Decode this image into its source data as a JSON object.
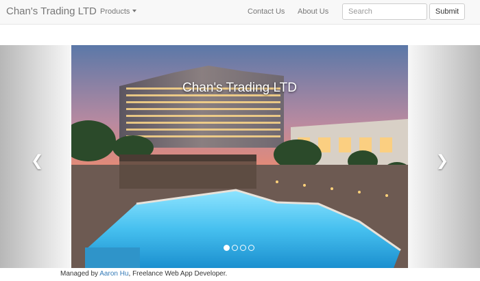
{
  "navbar": {
    "brand": "Chan's Trading LTD",
    "products_label": "Products",
    "contact_label": "Contact Us",
    "about_label": "About Us",
    "search_placeholder": "Search",
    "submit_label": "Submit"
  },
  "carousel": {
    "caption": "Chan's Trading LTD",
    "left_icon": "chevron-left-icon",
    "right_icon": "chevron-right-icon",
    "indicator_count": 4,
    "active_indicator": 1
  },
  "footer": {
    "prefix": "Managed by ",
    "author_link": "Aaron Hu",
    "suffix": ", Freelance Web App Developer."
  },
  "colors": {
    "navbar_bg": "#f8f8f8",
    "nav_text": "#777777",
    "link": "#337ab7",
    "pool": "#4fc3ee"
  }
}
